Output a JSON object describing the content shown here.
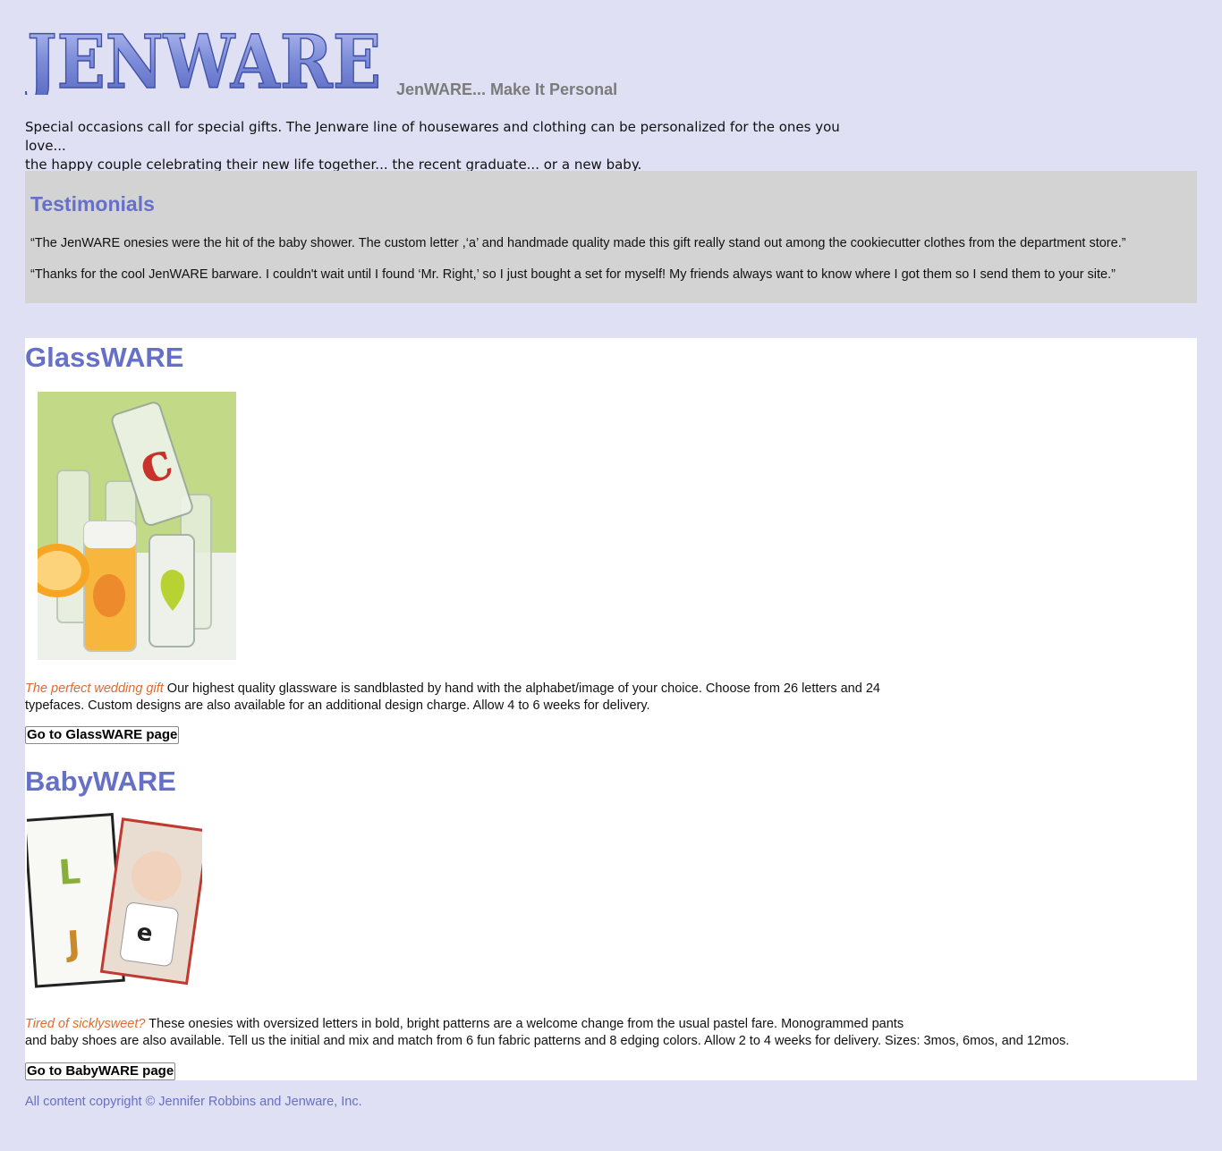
{
  "header": {
    "logo_text": "JENWARE",
    "tagline": "JenWARE... Make It Personal"
  },
  "intro": {
    "line1": "Special occasions call for special gifts. The Jenware line of housewares and clothing can be personalized for the ones you love...",
    "line2": "the happy couple celebrating their new life together... the recent graduate... or a new baby."
  },
  "testimonials": {
    "title": "Testimonials",
    "quotes": [
      "“The JenWARE onesies were the hit of the baby shower. The custom letter ,‘a’ and handmade quality made this gift really stand out among the cookiecutter clothes from the department store.”",
      "“Thanks for the cool JenWARE barware. I couldn't wait until I found ‘Mr. Right,’ so I just bought a set for myself! My friends always want to know where I got them so I send them to your site.”"
    ]
  },
  "glassware": {
    "title": "GlassWARE",
    "lead": "The perfect wedding gift",
    "desc1": " Our highest quality glassware is sandblasted by hand with the alphabet/image of your choice. Choose from 26 letters and 24",
    "desc2": "typefaces. Custom designs are also available for an additional design charge. Allow 4 to 6 weeks for delivery.",
    "button": "Go to GlassWARE page"
  },
  "babyware": {
    "title": "BabyWARE",
    "lead": "Tired of sicklysweet?",
    "desc1": "  These onesies with oversized letters in bold, bright patterns are a welcome change from the usual pastel fare. Monogrammed pants",
    "desc2": "and baby shoes are also available. Tell us the initial and mix and match from 6 fun fabric patterns and 8 edging colors. Allow 2 to 4 weeks for delivery. Sizes: 3mos, 6mos, and 12mos.",
    "button": "Go to BabyWARE page"
  },
  "footer": {
    "copyright": "All content copyright © Jennifer Robbins and Jenware, Inc."
  },
  "colors": {
    "page_bg": "#dfe0f3",
    "accent": "#6670c6",
    "lead": "#e06a2f",
    "panel": "#d3d3d3"
  }
}
